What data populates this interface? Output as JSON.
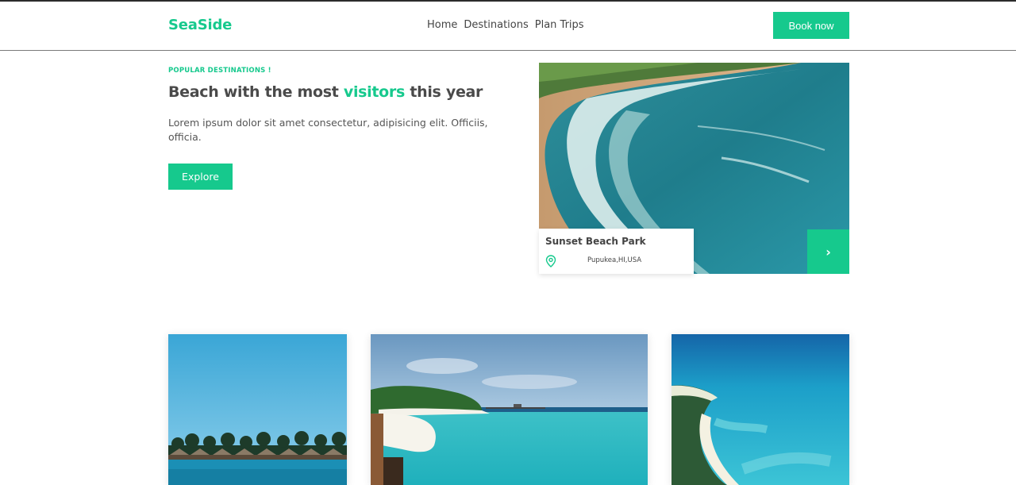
{
  "brand": {
    "name": "SeaSide",
    "accent_color": "#16c98d"
  },
  "nav": {
    "items": [
      "Home",
      "Destinations",
      "Plan Trips"
    ]
  },
  "header": {
    "book_label": "Book now"
  },
  "hero": {
    "kicker": "POPULAR DESTINATIONS !",
    "headline_pre": "Beach with the most ",
    "headline_accent": "visitors",
    "headline_post": " this year",
    "description": "Lorem ipsum dolor sit amet consectetur, adipisicing elit. Officiis, officia.",
    "explore_label": "Explore"
  },
  "featured": {
    "title": "Sunset Beach Park",
    "location": "Pupukea,HI,USA",
    "location_icon": "map-pin-icon",
    "next_icon": "chevron-right-icon",
    "next_glyph": "›"
  },
  "gallery": {
    "cards": [
      {
        "image": "overwater-bungalows-photo"
      },
      {
        "image": "tropical-island-lagoon-photo"
      },
      {
        "image": "aerial-reef-island-photo"
      }
    ]
  }
}
